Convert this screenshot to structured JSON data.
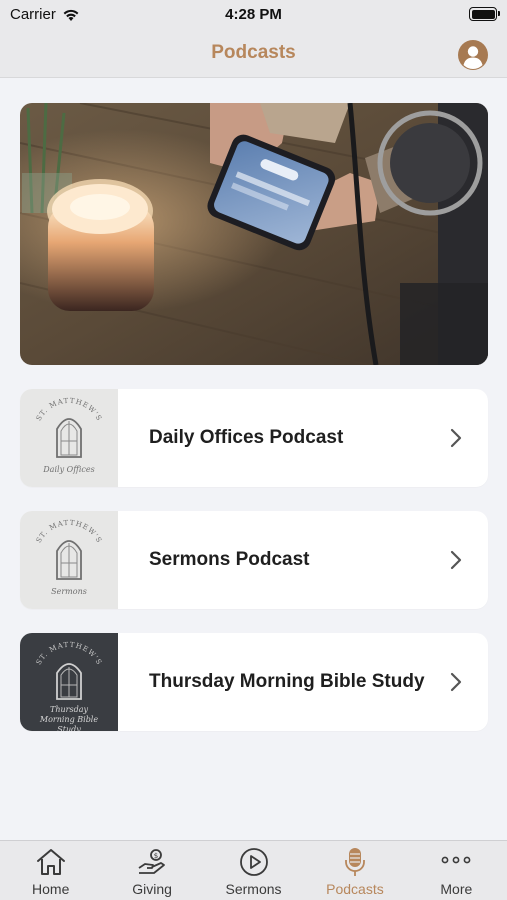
{
  "status_bar": {
    "carrier": "Carrier",
    "time": "4:28 PM"
  },
  "nav": {
    "title": "Podcasts",
    "profile_icon": "person-circle-icon"
  },
  "colors": {
    "accent": "#b7875c",
    "bar_background": "#e9e9eb",
    "page_background": "#f2f3f7"
  },
  "podcasts": [
    {
      "title": "Daily Offices Podcast",
      "thumb_caption": "Daily Offices",
      "thumb_brand": "ST. MATTHEW'S",
      "thumb_theme": "light"
    },
    {
      "title": "Sermons Podcast",
      "thumb_caption": "Sermons",
      "thumb_brand": "ST. MATTHEW'S",
      "thumb_theme": "light"
    },
    {
      "title": "Thursday Morning Bible Study",
      "thumb_caption": "Thursday Morning Bible Study",
      "thumb_brand": "ST. MATTHEW'S",
      "thumb_theme": "dark"
    }
  ],
  "tabs": [
    {
      "label": "Home",
      "icon": "house-icon",
      "active": false
    },
    {
      "label": "Giving",
      "icon": "hand-coin-icon",
      "active": false
    },
    {
      "label": "Sermons",
      "icon": "play-circle-icon",
      "active": false
    },
    {
      "label": "Podcasts",
      "icon": "microphone-icon",
      "active": true
    },
    {
      "label": "More",
      "icon": "more-dots-icon",
      "active": false
    }
  ]
}
